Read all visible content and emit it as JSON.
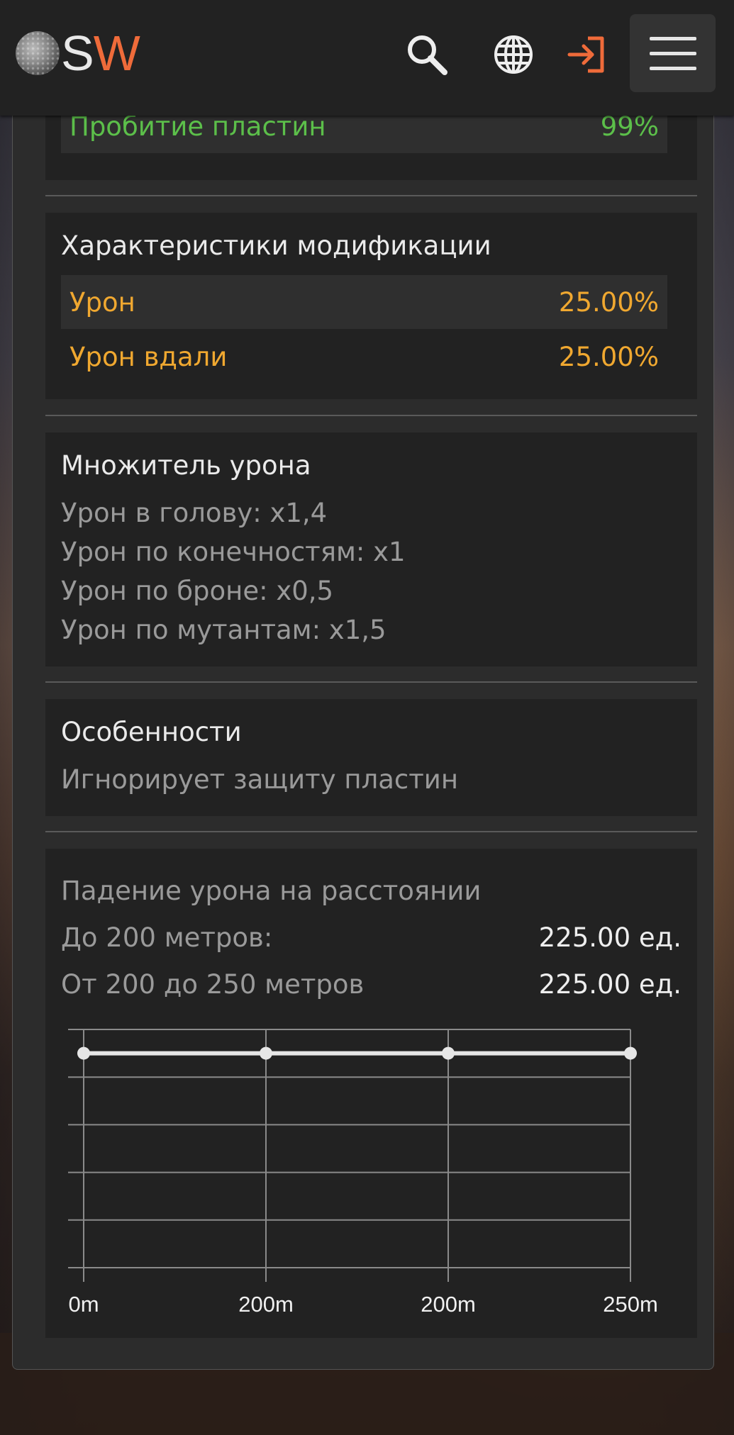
{
  "header": {
    "logo_s": "S",
    "logo_w": "W",
    "icons": [
      "search-icon",
      "globe-icon",
      "login-icon",
      "menu-icon"
    ],
    "accent_color": "#ef6b3a"
  },
  "penetration": {
    "label": "Пробитие пластин",
    "value": "99%"
  },
  "modification": {
    "title": "Характеристики модификации",
    "rows": [
      {
        "label": "Урон",
        "value": "25.00%"
      },
      {
        "label": "Урон вдали",
        "value": "25.00%"
      }
    ]
  },
  "multiplier": {
    "title": "Множитель урона",
    "lines": [
      "Урон в голову: x1,4",
      "Урон по конечностям: x1",
      "Урон по броне: x0,5",
      "Урон по мутантам: x1,5"
    ]
  },
  "features": {
    "title": "Особенности",
    "text": "Игнорирует защиту пластин"
  },
  "falloff": {
    "title": "Падение урона на расстоянии",
    "rows": [
      {
        "label": "До 200 метров:",
        "value": "225.00 ед."
      },
      {
        "label": "От 200 до 250 метров",
        "value": "225.00 ед."
      }
    ]
  },
  "chart_data": {
    "type": "line",
    "categories": [
      "0m",
      "200m",
      "200m",
      "250m"
    ],
    "series": [
      {
        "values": [
          225,
          225,
          225,
          225
        ]
      }
    ],
    "title": "",
    "xlabel": "",
    "ylabel": "",
    "ylim": [
      0,
      250
    ],
    "grid": true,
    "colors": {
      "line": "#e6e6e6",
      "grid": "#8a8a8a"
    }
  }
}
